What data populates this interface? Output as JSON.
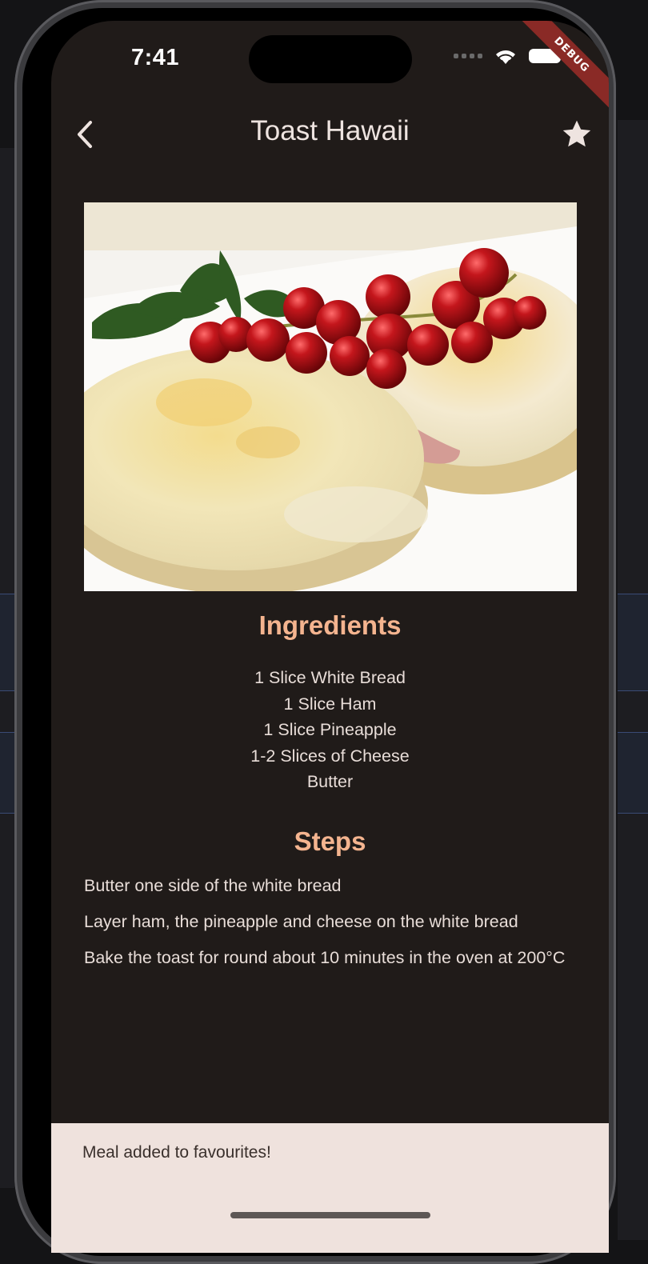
{
  "status_bar": {
    "time": "7:41",
    "debug_label": "DEBUG"
  },
  "app_bar": {
    "title": "Toast Hawaii"
  },
  "ingredients": {
    "heading": "Ingredients",
    "items": [
      "1 Slice White Bread",
      "1 Slice Ham",
      "1 Slice Pineapple",
      "1-2 Slices of Cheese",
      "Butter"
    ]
  },
  "steps": {
    "heading": "Steps",
    "items": [
      "Butter one side of the white bread",
      "Layer ham, the pineapple and cheese on the white bread",
      "Bake the toast for round about 10 minutes in the oven at 200°C"
    ]
  },
  "snackbar": {
    "message": "Meal added to favourites!"
  },
  "colors": {
    "screen_bg": "#201b19",
    "accent": "#f4b48f",
    "snackbar_bg": "#efe2dd"
  },
  "icons": {
    "back": "chevron-left-icon",
    "favorite": "star-icon",
    "wifi": "wifi-icon",
    "battery": "battery-icon"
  }
}
